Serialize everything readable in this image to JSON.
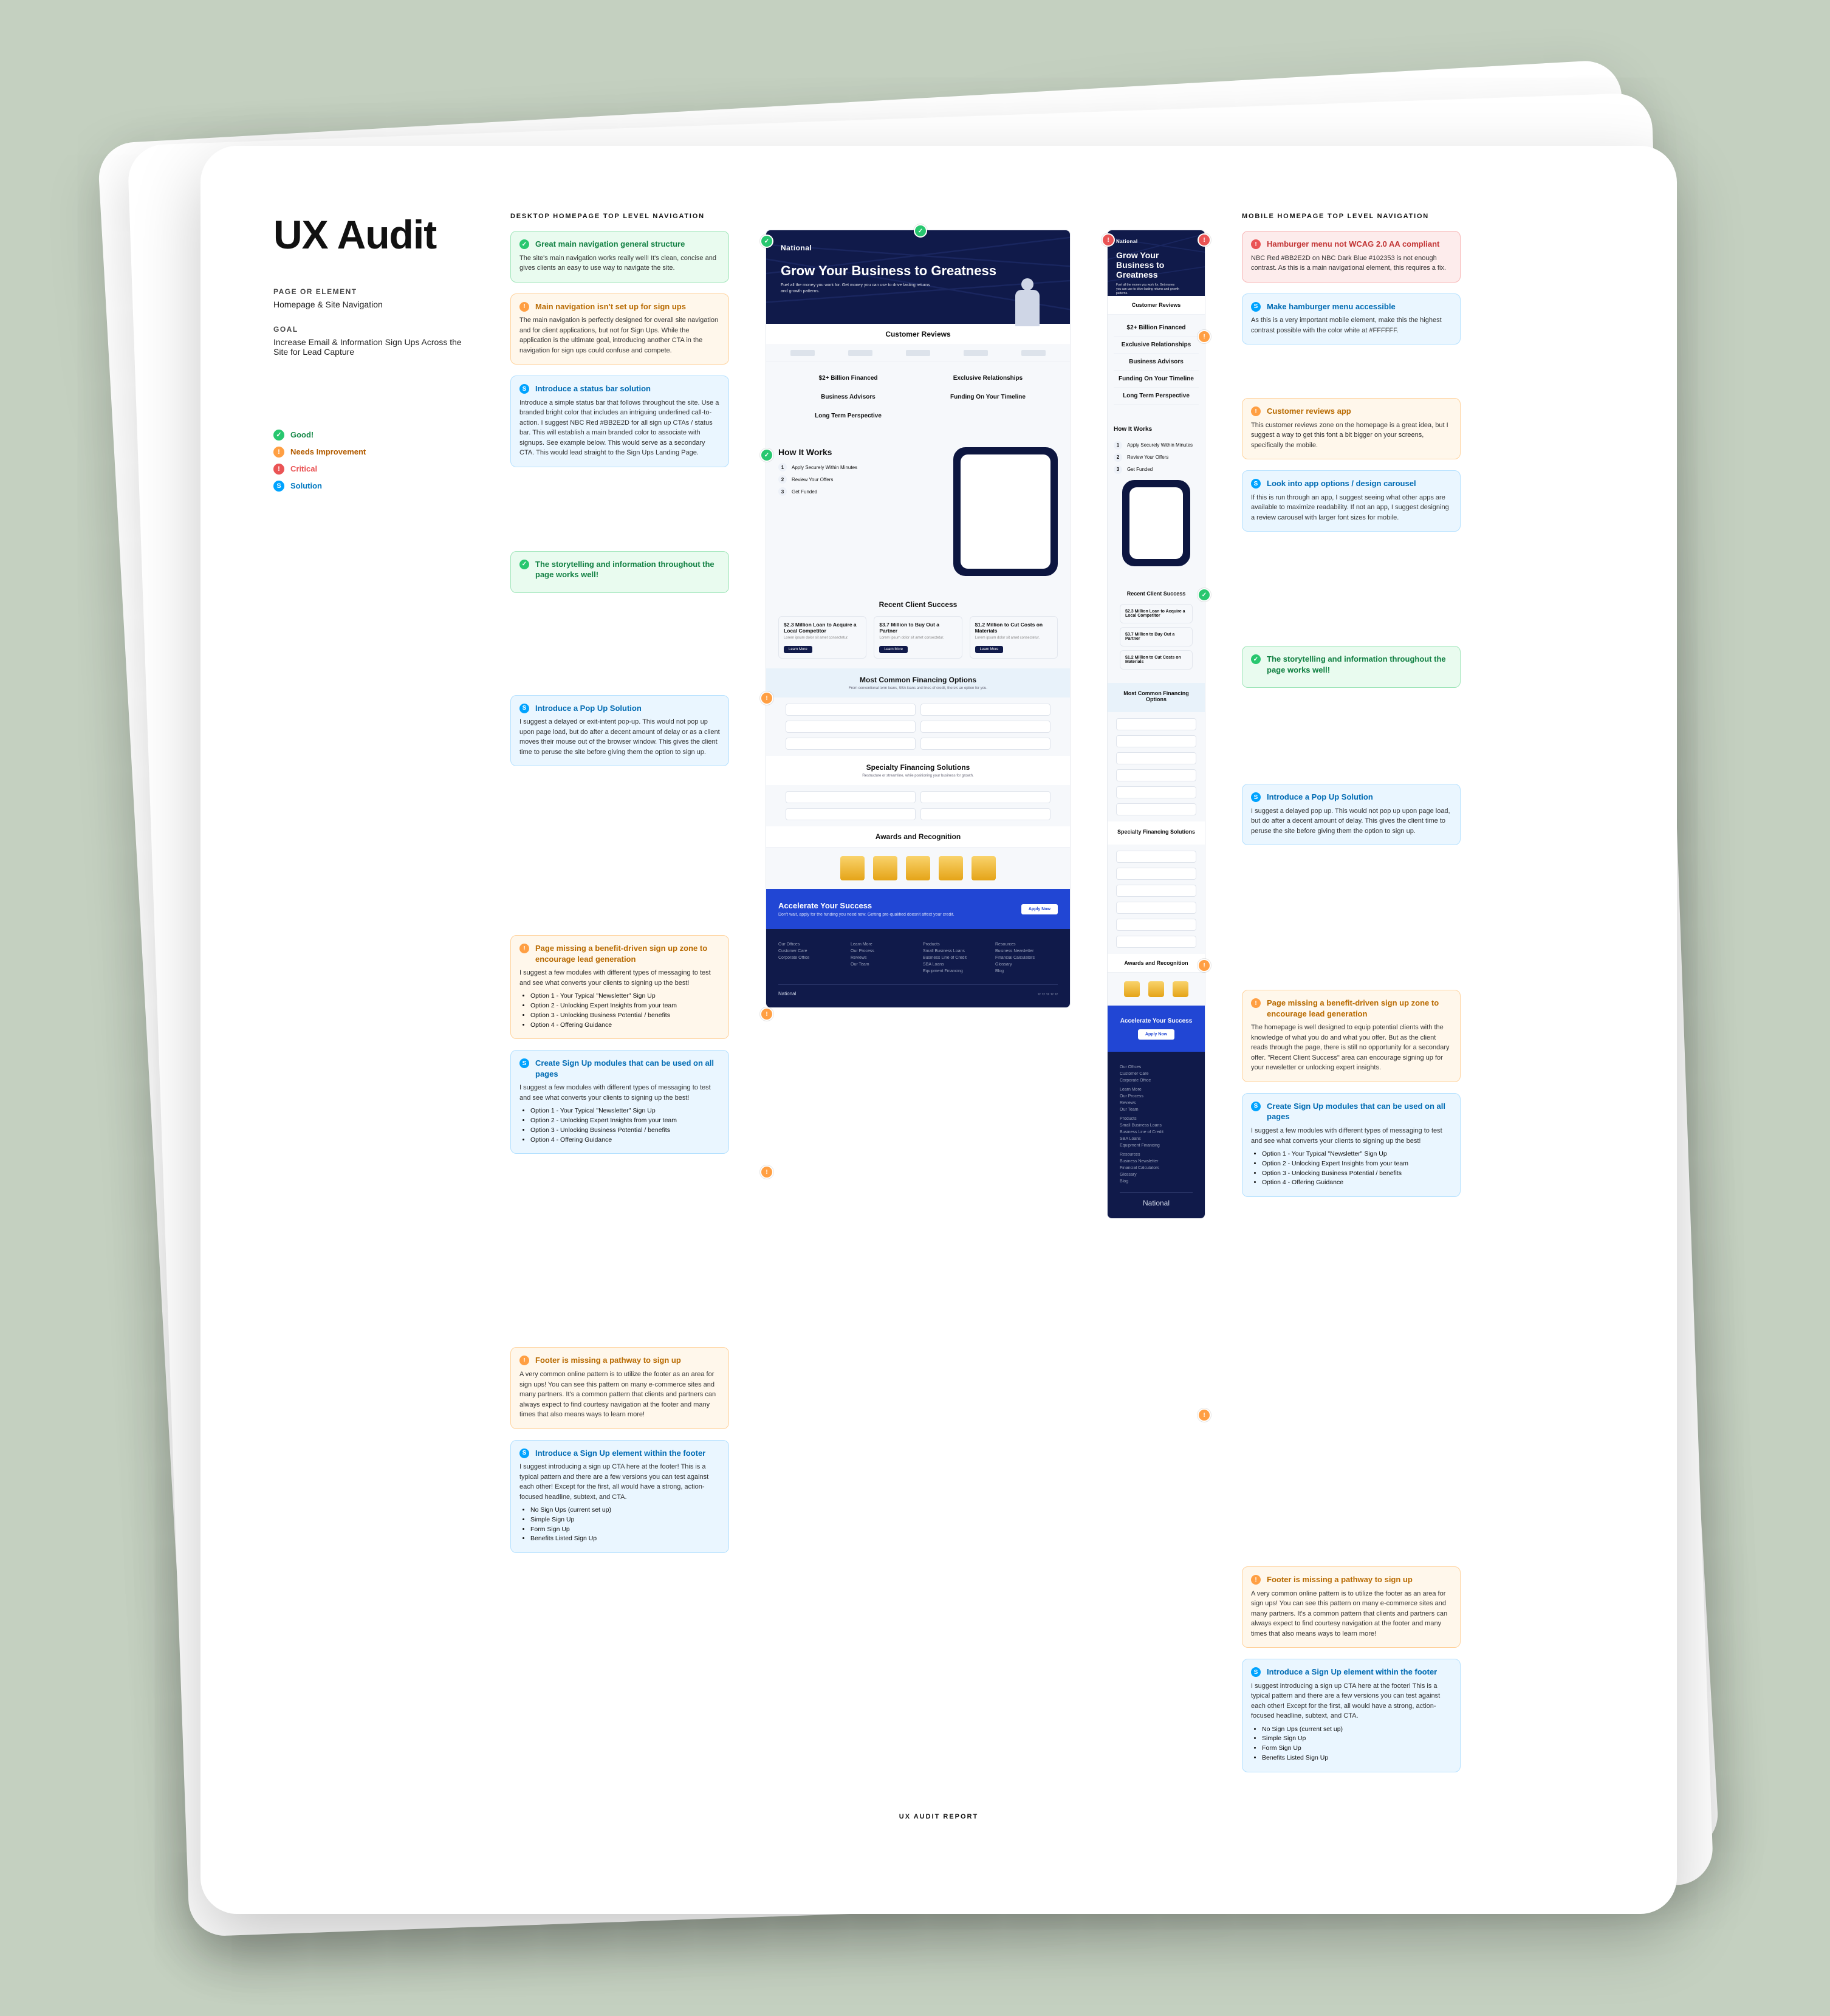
{
  "header": {
    "title": "UX Audit",
    "page_label": "PAGE OR ELEMENT",
    "page_value": "Homepage & Site Navigation",
    "goal_label": "GOAL",
    "goal_value": "Increase Email & Information Sign Ups Across the Site for Lead Capture"
  },
  "legend": {
    "good": "Good!",
    "needs": "Needs Improvement",
    "critical": "Critical",
    "solution": "Solution"
  },
  "sections": {
    "desktop_title": "DESKTOP HOMEPAGE TOP LEVEL NAVIGATION",
    "mobile_title": "MOBILE HOMEPAGE TOP LEVEL NAVIGATION"
  },
  "notes_desktop": [
    {
      "type": "g",
      "title": "Great main navigation general structure",
      "body": "The site's main navigation works really well! It's clean, concise and gives clients an easy to use way to navigate the site."
    },
    {
      "type": "y",
      "title": "Main navigation isn't set up for sign ups",
      "body": "The main navigation is perfectly designed for overall site navigation and for client applications, but not for Sign Ups. While the application is the ultimate goal, introducing another CTA in the navigation for sign ups could confuse and compete."
    },
    {
      "type": "b",
      "title": "Introduce a status bar solution",
      "body": "Introduce a simple status bar that follows throughout the site. Use a branded bright color that includes an intriguing underlined call-to-action. I suggest NBC Red #BB2E2D for all sign up CTAs / status bar. This will establish a main branded color to associate with signups. See example below. This would serve as a secondary CTA. This would lead straight to the Sign Ups Landing Page."
    },
    {
      "type": "g",
      "title": "The storytelling and information throughout the page works well!",
      "body": ""
    },
    {
      "type": "b",
      "title": "Introduce a Pop Up Solution",
      "body": "I suggest a delayed or exit-intent pop-up. This would not pop up upon page load, but do after a decent amount of delay or as a client moves their mouse out of the browser window. This gives the client time to peruse the site before giving them the option to sign up."
    },
    {
      "type": "y",
      "title": "Page missing a benefit-driven sign up zone to encourage lead generation",
      "body": "I suggest a few modules with different types of messaging to test and see what converts your clients to signing up the best!",
      "list": [
        "Option 1 - Your Typical \"Newsletter\" Sign Up",
        "Option 2 - Unlocking Expert Insights from your team",
        "Option 3 - Unlocking Business Potential / benefits",
        "Option 4 - Offering Guidance"
      ]
    },
    {
      "type": "b",
      "title": "Create Sign Up modules that can be used on all pages",
      "body": "I suggest a few modules with different types of messaging to test and see what converts your clients to signing up the best!",
      "list": [
        "Option 1 - Your Typical \"Newsletter\" Sign Up",
        "Option 2 - Unlocking Expert Insights from your team",
        "Option 3 - Unlocking Business Potential / benefits",
        "Option 4 - Offering Guidance"
      ]
    },
    {
      "type": "y",
      "title": "Footer is missing a pathway to sign up",
      "body": "A very common online pattern is to utilize the footer as an area for sign ups! You can see this pattern on many e-commerce sites and many partners. It's a common pattern that clients and partners can always expect to find courtesy navigation at the footer and many times that also means ways to learn more!"
    },
    {
      "type": "b",
      "title": "Introduce a Sign Up element within the footer",
      "body": "I suggest introducing a sign up CTA here at the footer! This is a typical pattern and there are a few versions you can test against each other! Except for the first, all would have a strong, action-focused headline, subtext, and CTA.",
      "list": [
        "No Sign Ups (current set up)",
        "Simple Sign Up",
        "Form Sign Up",
        "Benefits Listed Sign Up"
      ]
    }
  ],
  "notes_mobile": [
    {
      "type": "r",
      "title": "Hamburger menu not WCAG 2.0 AA compliant",
      "body": "NBC Red #BB2E2D on NBC Dark Blue #102353 is not enough contrast. As this is a main navigational element, this requires a fix."
    },
    {
      "type": "b",
      "title": "Make hamburger menu accessible",
      "body": "As this is a very important mobile element, make this the highest contrast possible with the color white at #FFFFFF."
    },
    {
      "type": "y",
      "title": "Customer reviews app",
      "body": "This customer reviews zone on the homepage is a great idea, but I suggest a way to get this font a bit bigger on your screens, specifically the mobile."
    },
    {
      "type": "b",
      "title": "Look into app options / design carousel",
      "body": "If this is run through an app, I suggest seeing what other apps are available to maximize readability. If not an app, I suggest designing a review carousel with larger font sizes for mobile."
    },
    {
      "type": "g",
      "title": "The storytelling and information throughout the page works well!",
      "body": ""
    },
    {
      "type": "b",
      "title": "Introduce a Pop Up Solution",
      "body": "I suggest a delayed pop up. This would not pop up upon page load, but do after a decent amount of delay. This gives the client time to peruse the site before giving them the option to sign up."
    },
    {
      "type": "y",
      "title": "Page missing a benefit-driven sign up zone to encourage lead generation",
      "body": "The homepage is well designed to equip potential clients with the knowledge of what you do and what you offer. But as the client reads through the page, there is still no opportunity for a secondary offer. \"Recent Client Success\" area can encourage signing up for your newsletter or unlocking expert insights."
    },
    {
      "type": "b",
      "title": "Create Sign Up modules that can be used on all pages",
      "body": "I suggest a few modules with different types of messaging to test and see what converts your clients to signing up the best!",
      "list": [
        "Option 1 - Your Typical \"Newsletter\" Sign Up",
        "Option 2 - Unlocking Expert Insights from your team",
        "Option 3 - Unlocking Business Potential / benefits",
        "Option 4 - Offering Guidance"
      ]
    },
    {
      "type": "y",
      "title": "Footer is missing a pathway to sign up",
      "body": "A very common online pattern is to utilize the footer as an area for sign ups! You can see this pattern on many e-commerce sites and many partners. It's a common pattern that clients and partners can always expect to find courtesy navigation at the footer and many times that also means ways to learn more!"
    },
    {
      "type": "b",
      "title": "Introduce a Sign Up element within the footer",
      "body": "I suggest introducing a sign up CTA here at the footer! This is a typical pattern and there are a few versions you can test against each other! Except for the first, all would have a strong, action-focused headline, subtext, and CTA.",
      "list": [
        "No Sign Ups (current set up)",
        "Simple Sign Up",
        "Form Sign Up",
        "Benefits Listed Sign Up"
      ]
    }
  ],
  "mock": {
    "brand": "National",
    "hero_title": "Grow Your Business to Greatness",
    "hero_sub": "Fuel all the money you work for. Get money you can use to drive lasting returns and growth patterns.",
    "reviews_title": "Customer Reviews",
    "features": [
      "$2+ Billion Financed",
      "Exclusive Relationships",
      "Business Advisors",
      "Funding On Your Timeline",
      "Long Term Perspective"
    ],
    "hiw_title": "How It Works",
    "hiw_steps": [
      "Apply Securely Within Minutes",
      "Review Your Offers",
      "Get Funded"
    ],
    "cases_title": "Recent Client Success",
    "case1": "$2.3 Million Loan to Acquire a Local Competitor",
    "case2": "$3.7 Million to Buy Out a Partner",
    "case3": "$1.2 Million to Cut Costs on Materials",
    "band1_title": "Most Common Financing Options",
    "band1_sub": "From conventional term loans, SBA loans and lines of credit, there's an option for you.",
    "band2_title": "Specialty Financing Solutions",
    "band2_sub": "Restructure or streamline, while positioning your business for growth.",
    "awards_title": "Awards and Recognition",
    "cta_title": "Accelerate Your Success",
    "cta_sub": "Don't wait, apply for the funding you need now. Getting pre-qualified doesn't affect your credit.",
    "cta_button": "Apply Now",
    "footer_cols": [
      [
        "Our Offices",
        "Customer Care",
        "Corporate Office"
      ],
      [
        "Learn More",
        "Our Process",
        "Reviews",
        "Our Team"
      ],
      [
        "Products",
        "Small Business Loans",
        "Business Line of Credit",
        "SBA Loans",
        "Equipment Financing"
      ],
      [
        "Resources",
        "Business Newsletter",
        "Financial Calculators",
        "Glossary",
        "Blog"
      ]
    ]
  },
  "footer_label": "UX AUDIT REPORT"
}
